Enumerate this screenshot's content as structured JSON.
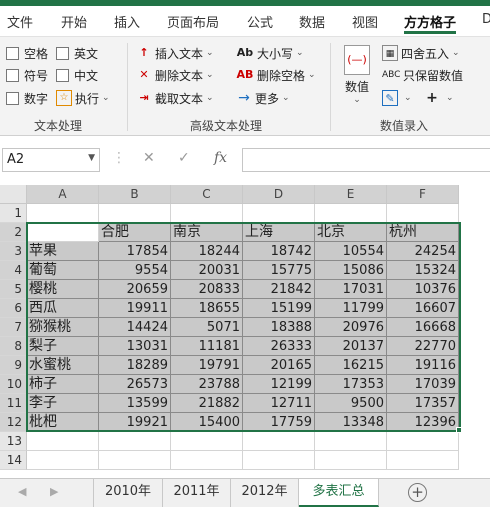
{
  "ribbon_tabs": [
    "文件",
    "开始",
    "插入",
    "页面布局",
    "公式",
    "数据",
    "视图",
    "方方格子",
    "D"
  ],
  "active_tab": "方方格子",
  "groups": {
    "text": {
      "label": "文本处理",
      "items": [
        "空格",
        "英文",
        "符号",
        "中文",
        "数字",
        "执行"
      ]
    },
    "advanced": {
      "label": "高级文本处理",
      "items": [
        "插入文本",
        "删除文本",
        "截取文本",
        "大小写",
        "删除空格",
        "更多"
      ]
    },
    "entry": {
      "label": "数值录入",
      "big_button": "数值",
      "round": "四舍五入",
      "keep_values": "只保留数值"
    }
  },
  "formula_bar": {
    "name_box": "A2",
    "cancel": "✕",
    "confirm": "✓",
    "fx": "fx",
    "value": ""
  },
  "columns": [
    "A",
    "B",
    "C",
    "D",
    "E",
    "F"
  ],
  "rows": [
    "1",
    "2",
    "3",
    "4",
    "5",
    "6",
    "7",
    "8",
    "9",
    "10",
    "11",
    "12",
    "13",
    "14"
  ],
  "table": {
    "header": [
      "",
      "合肥",
      "南京",
      "上海",
      "北京",
      "杭州"
    ],
    "data": [
      [
        "苹果",
        "17854",
        "18244",
        "18742",
        "10554",
        "24254"
      ],
      [
        "葡萄",
        "9554",
        "20031",
        "15775",
        "15086",
        "15324"
      ],
      [
        "樱桃",
        "20659",
        "20833",
        "21842",
        "17031",
        "10376"
      ],
      [
        "西瓜",
        "19911",
        "18655",
        "15199",
        "11799",
        "16607"
      ],
      [
        "猕猴桃",
        "14424",
        "5071",
        "18388",
        "20976",
        "16668"
      ],
      [
        "梨子",
        "13031",
        "11181",
        "26333",
        "20137",
        "22770"
      ],
      [
        "水蜜桃",
        "18289",
        "19791",
        "20165",
        "16215",
        "19116"
      ],
      [
        "柿子",
        "26573",
        "23788",
        "12199",
        "17353",
        "17039"
      ],
      [
        "李子",
        "13599",
        "21882",
        "12711",
        "9500",
        "17357"
      ],
      [
        "枇杷",
        "19921",
        "15400",
        "17759",
        "13348",
        "12396"
      ]
    ]
  },
  "sheets": [
    "2010年",
    "2011年",
    "2012年",
    "多表汇总"
  ],
  "active_sheet": "多表汇总",
  "add_sheet": "+"
}
